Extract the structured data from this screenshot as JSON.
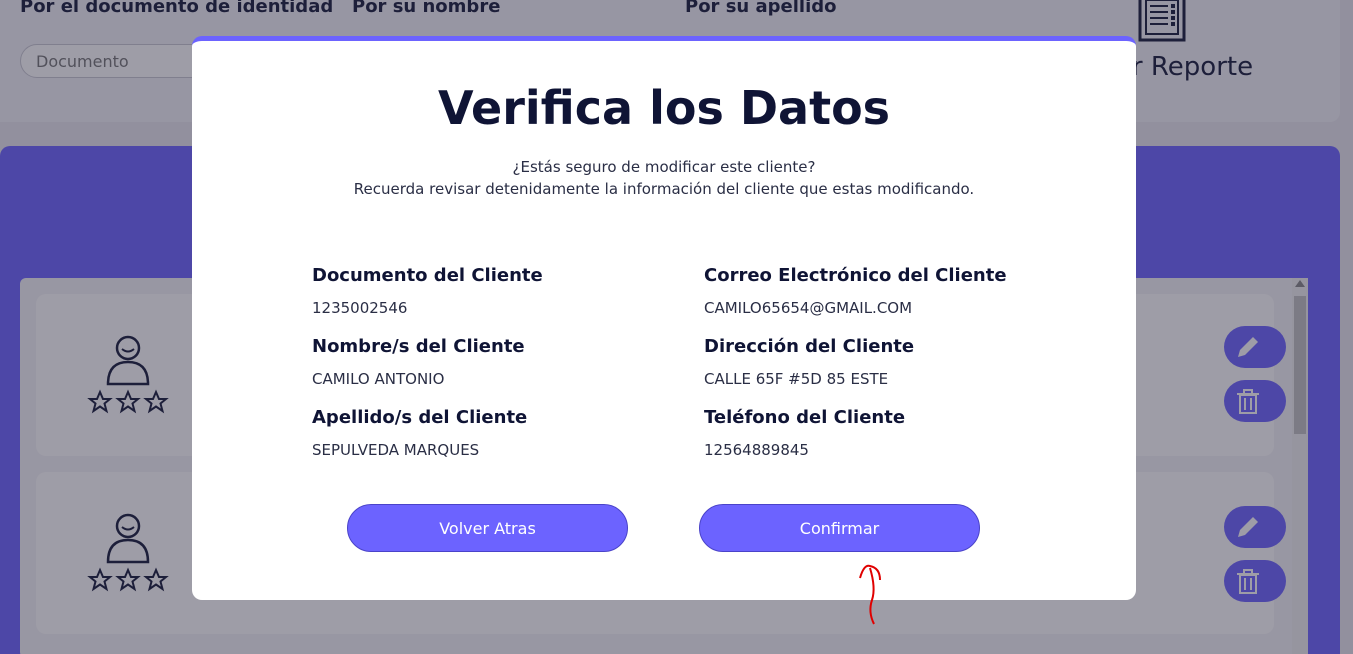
{
  "filters": {
    "by_document_label": "Por el documento de identidad",
    "by_name_label": "Por su nombre",
    "by_lastname_label": "Por su apellido",
    "document_placeholder": "Documento"
  },
  "report": {
    "label": "ar Reporte"
  },
  "modal": {
    "title": "Verifica los Datos",
    "subtitle_line1": "¿Estás seguro de modificar este cliente?",
    "subtitle_line2": "Recuerda revisar detenidamente la información del cliente que estas modificando.",
    "fields": {
      "document": {
        "label": "Documento del Cliente",
        "value": "1235002546"
      },
      "email": {
        "label": "Correo Electrónico del Cliente",
        "value": "CAMILO65654@GMAIL.COM"
      },
      "names": {
        "label": "Nombre/s del Cliente",
        "value": "CAMILO ANTONIO"
      },
      "address": {
        "label": "Dirección del Cliente",
        "value": "CALLE 65F #5D 85 ESTE"
      },
      "lastnames": {
        "label": "Apellido/s del Cliente",
        "value": "SEPULVEDA MARQUES"
      },
      "phone": {
        "label": "Teléfono del Cliente",
        "value": "12564889845"
      }
    },
    "back_button": "Volver Atras",
    "confirm_button": "Confirmar"
  },
  "colors": {
    "accent": "#6c63ff",
    "title": "#0f1435",
    "annotation": "#e00000"
  },
  "icons": [
    "report-icon",
    "user-avatar-icon",
    "star-icon",
    "pencil-icon",
    "trash-icon"
  ]
}
